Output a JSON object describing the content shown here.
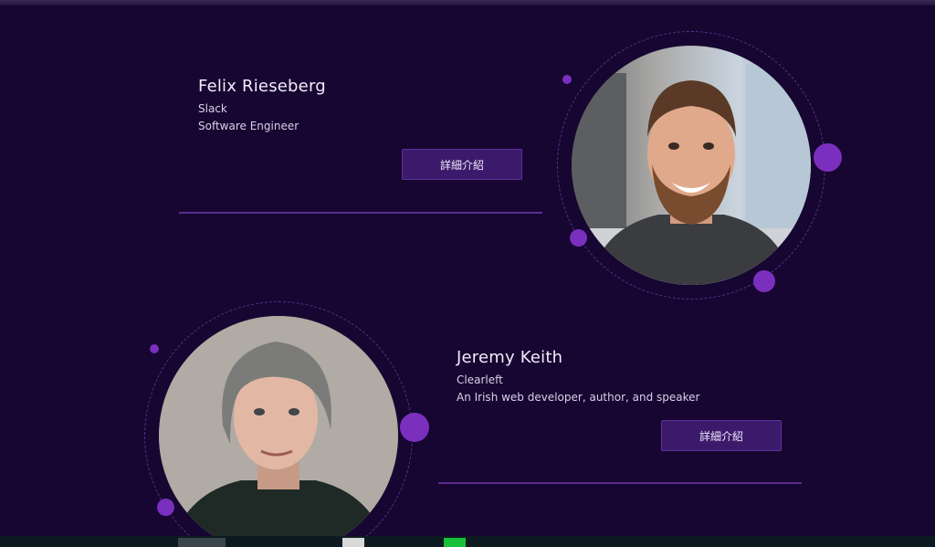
{
  "speakers": [
    {
      "name": "Felix Rieseberg",
      "company": "Slack",
      "title": "Software Engineer",
      "button_label": "詳細介紹",
      "photo_icon": "speaker-photo-felix"
    },
    {
      "name": "Jeremy Keith",
      "company": "Clearleft",
      "title": "An Irish web developer, author, and speaker",
      "button_label": "詳細介紹",
      "photo_icon": "speaker-photo-jeremy"
    }
  ],
  "colors": {
    "background": "#160631",
    "accent": "#7b2fbe",
    "button": "#3c1a6b",
    "divider": "#5b2a92"
  }
}
